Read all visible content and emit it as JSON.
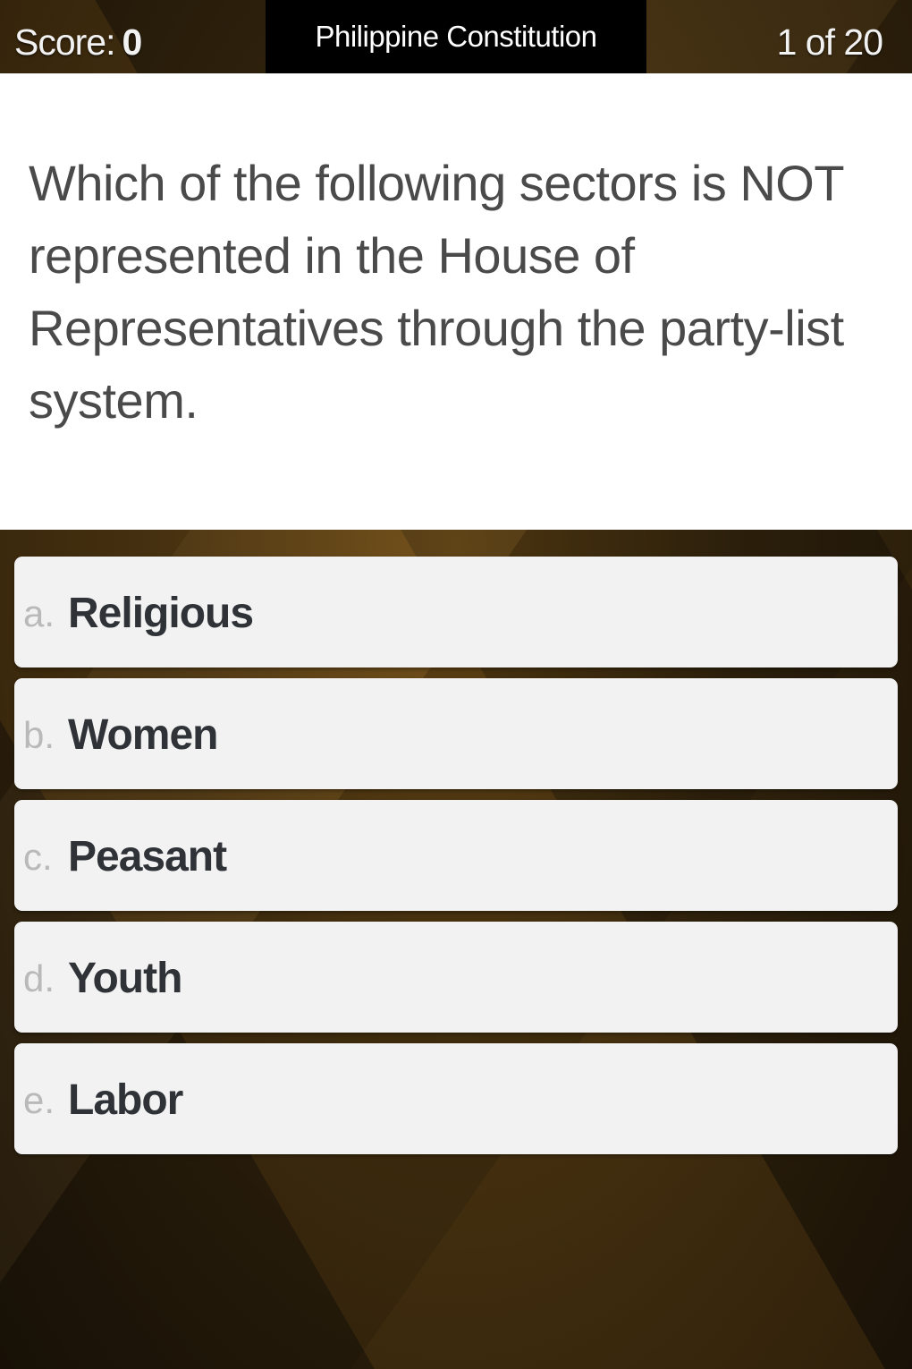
{
  "header": {
    "score_label": "Score:",
    "score_value": "0",
    "title": "Philippine Constitution",
    "progress": "1 of 20"
  },
  "question": {
    "text": "Which of the following sectors is NOT represented in the House of Representatives through the party-list system."
  },
  "answers": [
    {
      "letter": "a.",
      "text": "Religious"
    },
    {
      "letter": "b.",
      "text": "Women"
    },
    {
      "letter": "c.",
      "text": "Peasant"
    },
    {
      "letter": "d.",
      "text": "Youth"
    },
    {
      "letter": "e.",
      "text": "Labor"
    }
  ],
  "colors": {
    "title_bar": "#000000",
    "answer_background": "#f2f2f2",
    "answer_text": "#2f3338",
    "question_text": "#4a4a4a",
    "background": "#3b2a0f"
  }
}
